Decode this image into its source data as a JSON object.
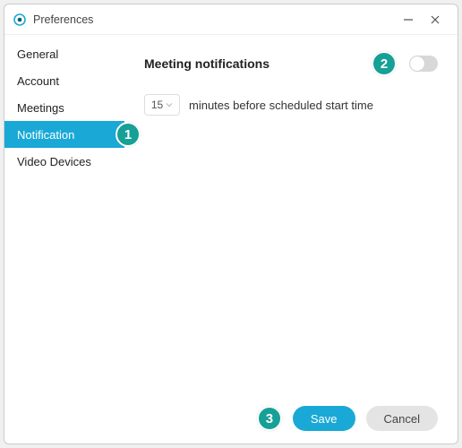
{
  "window": {
    "title": "Preferences"
  },
  "sidebar": {
    "items": [
      {
        "label": "General"
      },
      {
        "label": "Account"
      },
      {
        "label": "Meetings"
      },
      {
        "label": "Notification"
      },
      {
        "label": "Video Devices"
      }
    ],
    "activeIndex": 3
  },
  "panel": {
    "title": "Meeting notifications",
    "minutes_value": "15",
    "minutes_label": "minutes before scheduled start time"
  },
  "footer": {
    "save_label": "Save",
    "cancel_label": "Cancel"
  },
  "callouts": {
    "c1": "1",
    "c2": "2",
    "c3": "3"
  },
  "colors": {
    "accent": "#1aa9d6",
    "callout": "#16a096"
  }
}
